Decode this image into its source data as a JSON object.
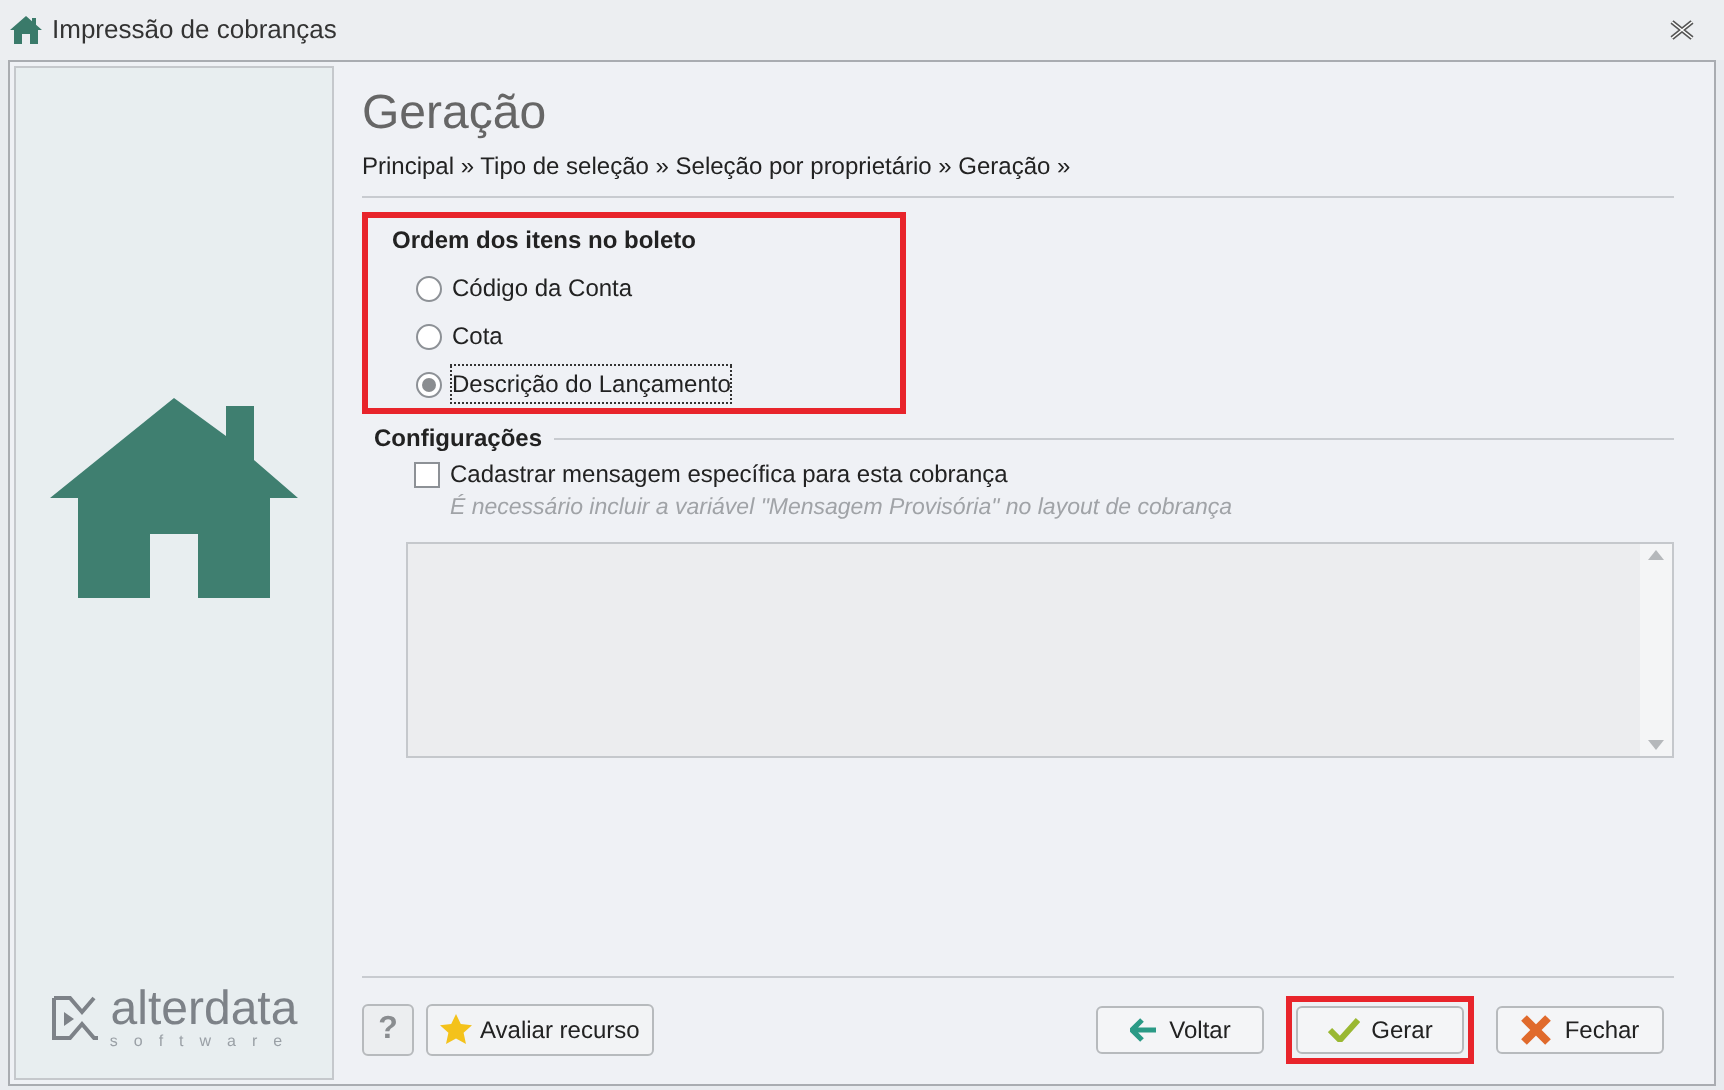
{
  "window": {
    "title": "Impressão de cobranças"
  },
  "logo": {
    "name": "alterdata",
    "tagline": "software"
  },
  "page": {
    "title": "Geração",
    "breadcrumb": "Principal » Tipo de seleção » Seleção por proprietário » Geração »"
  },
  "order_group": {
    "title": "Ordem dos itens no boleto",
    "highlighted": true,
    "options": [
      {
        "label": "Código da Conta",
        "selected": false
      },
      {
        "label": "Cota",
        "selected": false
      },
      {
        "label": "Descrição do Lançamento",
        "selected": true
      }
    ]
  },
  "settings_group": {
    "title": "Configurações",
    "checkbox": {
      "label": "Cadastrar mensagem específica para esta cobrança",
      "checked": false
    },
    "hint": "É necessário incluir a variável \"Mensagem Provisória\" no layout de cobrança"
  },
  "footer": {
    "help": "?",
    "rate": "Avaliar recurso",
    "buttons": [
      {
        "kind": "back",
        "label": "Voltar",
        "highlighted": false
      },
      {
        "kind": "confirm",
        "label": "Gerar",
        "highlighted": true
      },
      {
        "kind": "close",
        "label": "Fechar",
        "highlighted": false
      }
    ]
  }
}
